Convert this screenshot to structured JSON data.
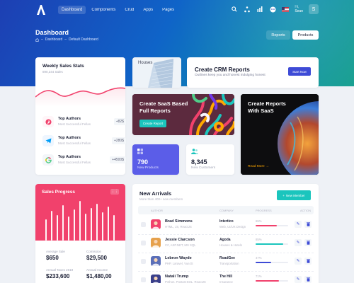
{
  "nav": {
    "items": [
      {
        "label": "Dashboard",
        "active": true
      },
      {
        "label": "Components",
        "active": false
      },
      {
        "label": "Crud",
        "active": false
      },
      {
        "label": "Apps",
        "active": false
      },
      {
        "label": "Pages",
        "active": false
      }
    ],
    "user_greeting": "Hi,",
    "user_name": "Sean",
    "user_initial": "S"
  },
  "header": {
    "title": "Dashboard",
    "breadcrumb": [
      "Dashboard",
      "Default Dashboard"
    ],
    "reports_label": "Reports",
    "products_label": "Products"
  },
  "weekly_sales": {
    "title": "Weekly Sales Stats",
    "subtitle": "890,344 Sales",
    "authors": [
      {
        "name": "Top Authors",
        "sub": "Most Successful Fellas",
        "value": "+82$",
        "color": "#f1416c",
        "bg": "#fff5f8",
        "icon": "pinterest-icon"
      },
      {
        "name": "Top Authors",
        "sub": "Most Successful Fellas",
        "value": "+280$",
        "color": "#009ef7",
        "bg": "#eef6ff",
        "icon": "telegram-icon"
      },
      {
        "name": "Top Authors",
        "sub": "Most Successful Fellas",
        "value": "+4500$",
        "color": "#50cd89",
        "bg": "#e8fff3",
        "icon": "google-icon"
      }
    ]
  },
  "houses": {
    "label": "Houses"
  },
  "crm": {
    "title": "Create CRM Reports",
    "subtitle": "Outlines keep you and honest indulging honest",
    "button": "Start Now"
  },
  "saas": {
    "title": "Create SaaS Based Full Reports",
    "button": "Create Report"
  },
  "create_reports": {
    "title": "Create Reports With SaaS",
    "link": "Read More",
    "arrow": "→"
  },
  "stats": {
    "products": {
      "value": "790",
      "label": "New Products"
    },
    "customers": {
      "value": "8,345",
      "label": "New Customers"
    }
  },
  "sales_progress": {
    "title": "Sales Progress",
    "menu": "⋮⋮",
    "stats": [
      {
        "label": "Average Sale",
        "value": "$650"
      },
      {
        "label": "Comission",
        "value": "$29,500"
      },
      {
        "label": "Annual Taxes 2019",
        "value": "$233,600"
      },
      {
        "label": "Annual Income",
        "value": "$1,480,00"
      }
    ]
  },
  "new_arrivals": {
    "title": "New Arrivals",
    "subtitle": "More than 400+ new members",
    "button": "New Member",
    "columns": [
      "AUTHOR",
      "COMPANY",
      "PROGRESS",
      "ACTION"
    ],
    "rows": [
      {
        "name": "Brad Simmons",
        "sub": "HTML, JS, ReactJS",
        "company": "Intertico",
        "company_sub": "Web, UI/UX Design",
        "progress": 65,
        "progress_label": "65%",
        "color": "#f1416c",
        "avatar_bg": "#f1416c"
      },
      {
        "name": "Jessie Clarcson",
        "sub": "C#, ASP.NET, MS SQL",
        "company": "Agoda",
        "company_sub": "Houses & Hotels",
        "progress": 85,
        "progress_label": "85%",
        "color": "#1bc5bd",
        "avatar_bg": "#e6a14c"
      },
      {
        "name": "Lebron Wayde",
        "sub": "PHP, Laravel, VueJS",
        "company": "RoadGee",
        "company_sub": "Transportation",
        "progress": 47,
        "progress_label": "47%",
        "color": "#3e4bd6",
        "avatar_bg": "#5b6fb8"
      },
      {
        "name": "Natali Trump",
        "sub": "Python, PostgreSQL, ReactJS",
        "company": "The Hill",
        "company_sub": "Insurance",
        "progress": 71,
        "progress_label": "71%",
        "color": "#f1416c",
        "avatar_bg": "#3a3f8a"
      }
    ]
  }
}
